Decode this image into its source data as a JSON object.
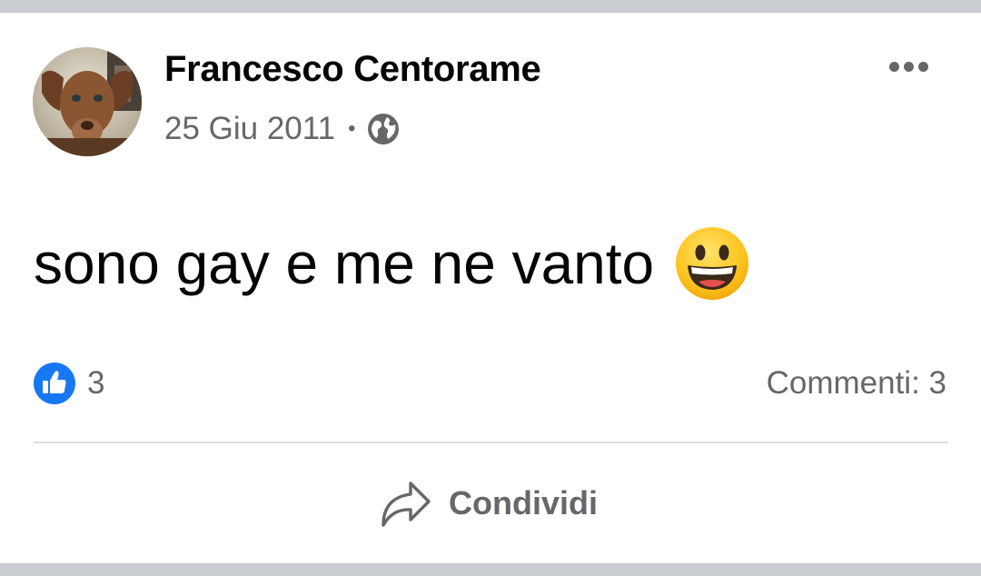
{
  "post": {
    "author": "Francesco Centorame",
    "date": "25 Giu 2011",
    "separator": "•",
    "audience_icon": "globe-icon",
    "text": "sono gay e me ne vanto",
    "emoji": "grinning-face",
    "more_icon": "more-options-icon"
  },
  "footer": {
    "like_count": "3",
    "comments": "Commenti: 3",
    "share_label": "Condividi",
    "share_icon": "share-arrow-icon"
  },
  "colors": {
    "like_blue": "#1877f2",
    "secondary_text": "#65676b",
    "background": "#c9ccd1"
  }
}
